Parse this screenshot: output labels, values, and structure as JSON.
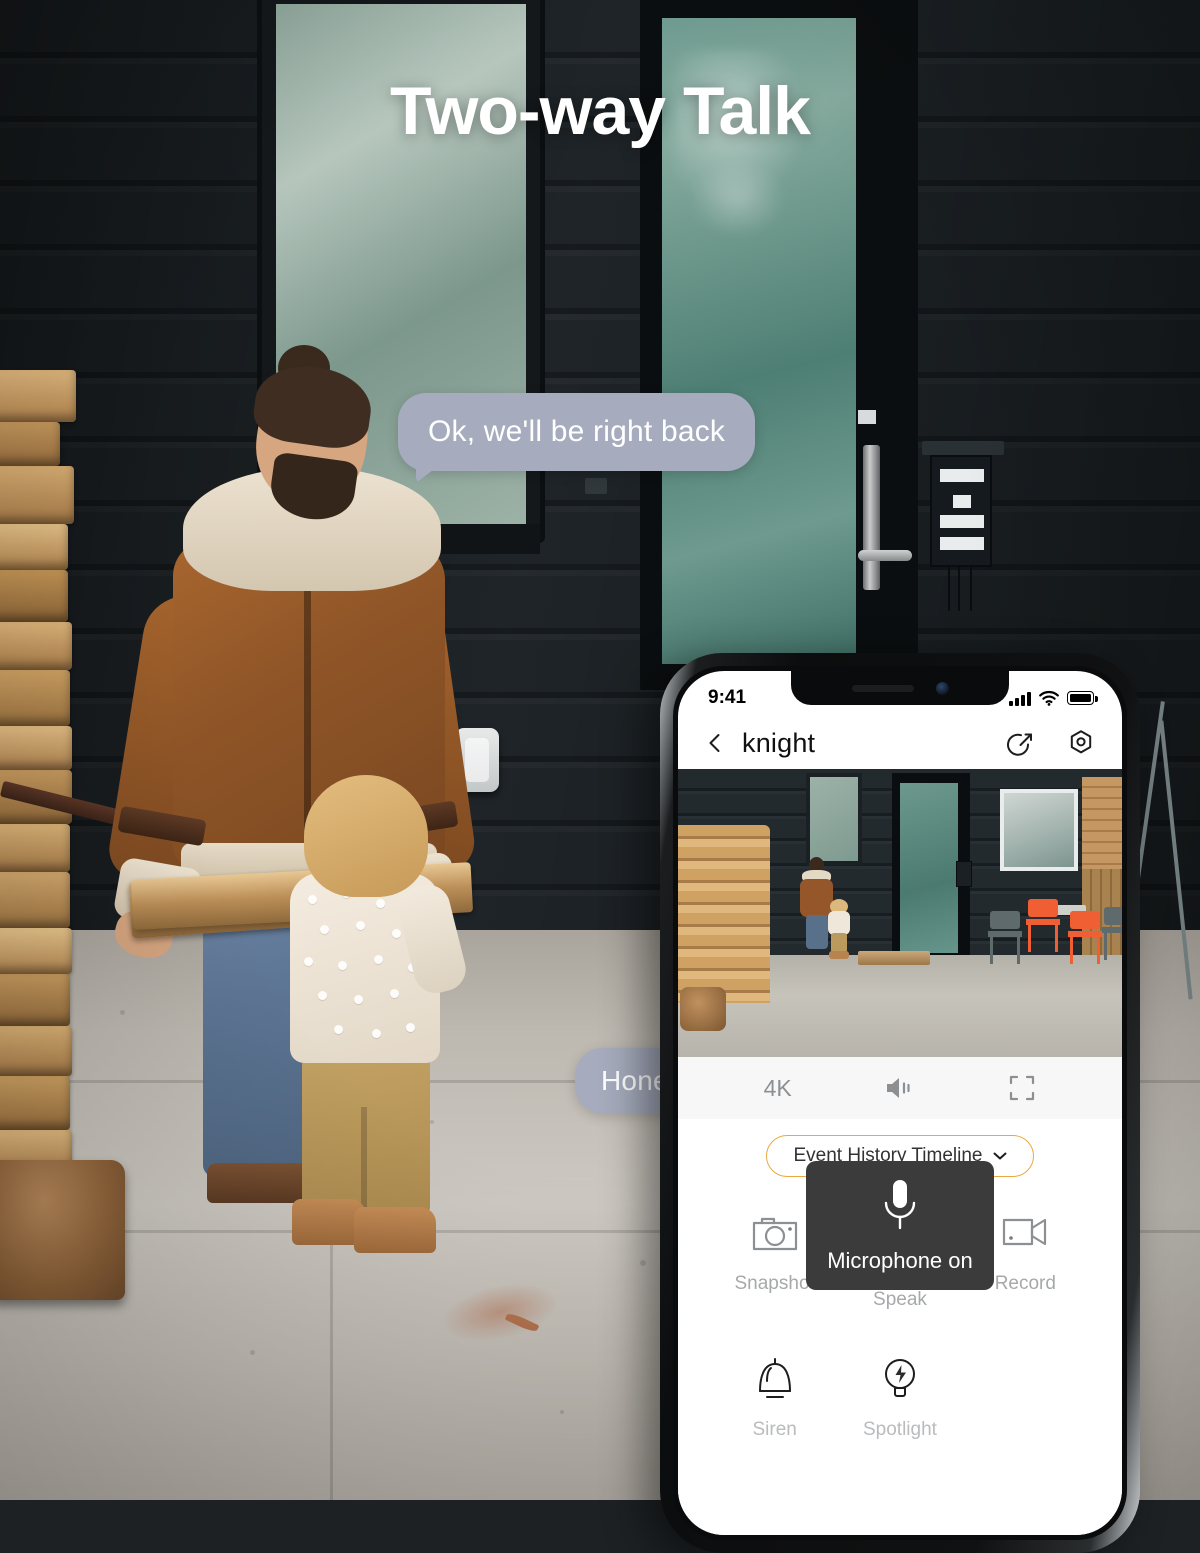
{
  "headline": "Two-way Talk",
  "conversation": [
    {
      "id": "bubble-1",
      "text": "Ok, we'll be right back"
    },
    {
      "id": "bubble-2",
      "text": "Honey, lunch is ready"
    }
  ],
  "phone": {
    "status_bar": {
      "time": "9:41",
      "icons": [
        "cellular-signal-icon",
        "wifi-icon",
        "battery-icon"
      ]
    },
    "nav": {
      "back_icon": "back-chevron-icon",
      "title": "knight",
      "share_icon": "share-icon",
      "settings_icon": "settings-hexagon-icon"
    },
    "live_view": {
      "label": "camera-live-feed"
    },
    "video_controls": {
      "quality": "4K",
      "speaker_icon": "speaker-on-icon",
      "fullscreen_icon": "fullscreen-icon"
    },
    "timeline": {
      "label": "Event History Timeline",
      "chevron_icon": "chevron-down-icon",
      "border_color": "#e9a93c"
    },
    "tooltip": {
      "icon": "microphone-icon",
      "label": "Microphone on",
      "background": "#3b3b3b"
    },
    "actions": [
      {
        "icon": "camera-snapshot-icon",
        "label": "Snapshot",
        "active": false
      },
      {
        "icon": "microphone-icon",
        "label": "Speak",
        "active": true,
        "accent": "#ee8f1c",
        "status_dot": "#27b74a"
      },
      {
        "icon": "video-record-icon",
        "label": "Record",
        "active": false
      }
    ],
    "bottom_actions": [
      {
        "icon": "siren-bell-icon",
        "label": "Siren"
      },
      {
        "icon": "spotlight-bulb-icon",
        "label": "Spotlight"
      },
      {
        "icon": "",
        "label": ""
      }
    ]
  },
  "colors": {
    "accent_orange": "#ee8f1c",
    "timeline_border": "#e9a93c",
    "bubble_background": "#a6acbd",
    "bubble_text": "#ffffff",
    "tooltip_background": "#3b3b3b",
    "status_dot_green": "#27b74a"
  }
}
